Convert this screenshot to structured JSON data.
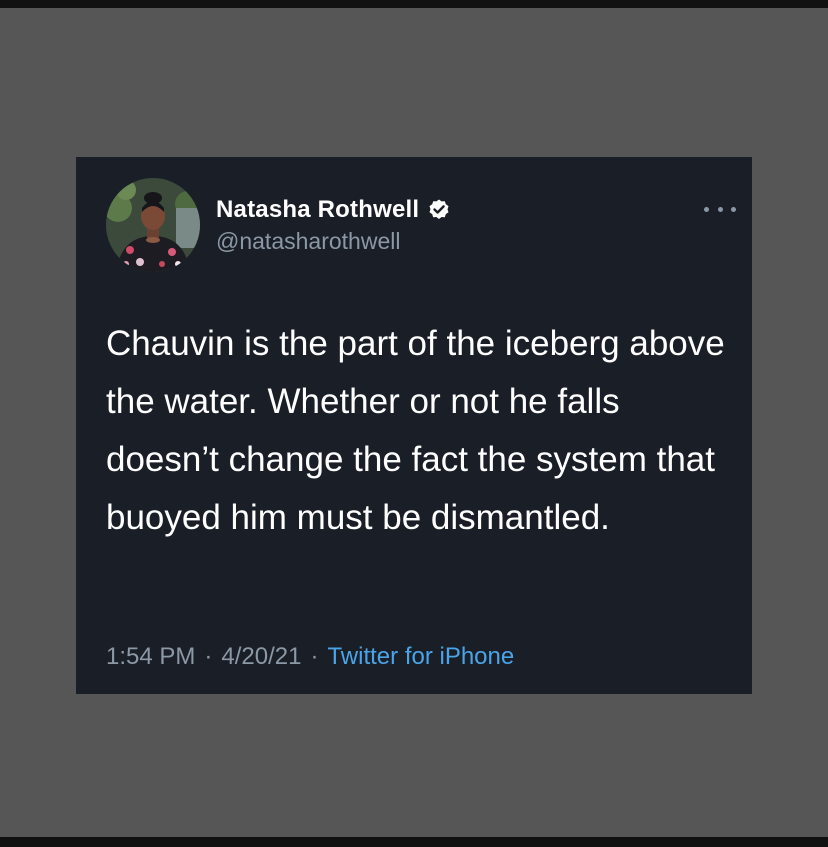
{
  "tweet": {
    "author": {
      "display_name": "Natasha Rothwell",
      "handle": "@natasharothwell",
      "verified": true,
      "verified_icon": "verified-badge-icon",
      "avatar_icon": "profile-photo"
    },
    "more_icon": "more-options-icon",
    "text": "Chauvin is the part of the iceberg above the water. Whether or not he falls doesn’t change the fact the system that buoyed him must be dismantled.",
    "time": "1:54 PM",
    "date": "4/20/21",
    "separator": "·",
    "source": "Twitter for iPhone"
  },
  "colors": {
    "page_background": "#565656",
    "card_background": "#1a1e27",
    "primary_text": "#ffffff",
    "secondary_text": "#8b98a5",
    "link": "#4aa4e8"
  }
}
